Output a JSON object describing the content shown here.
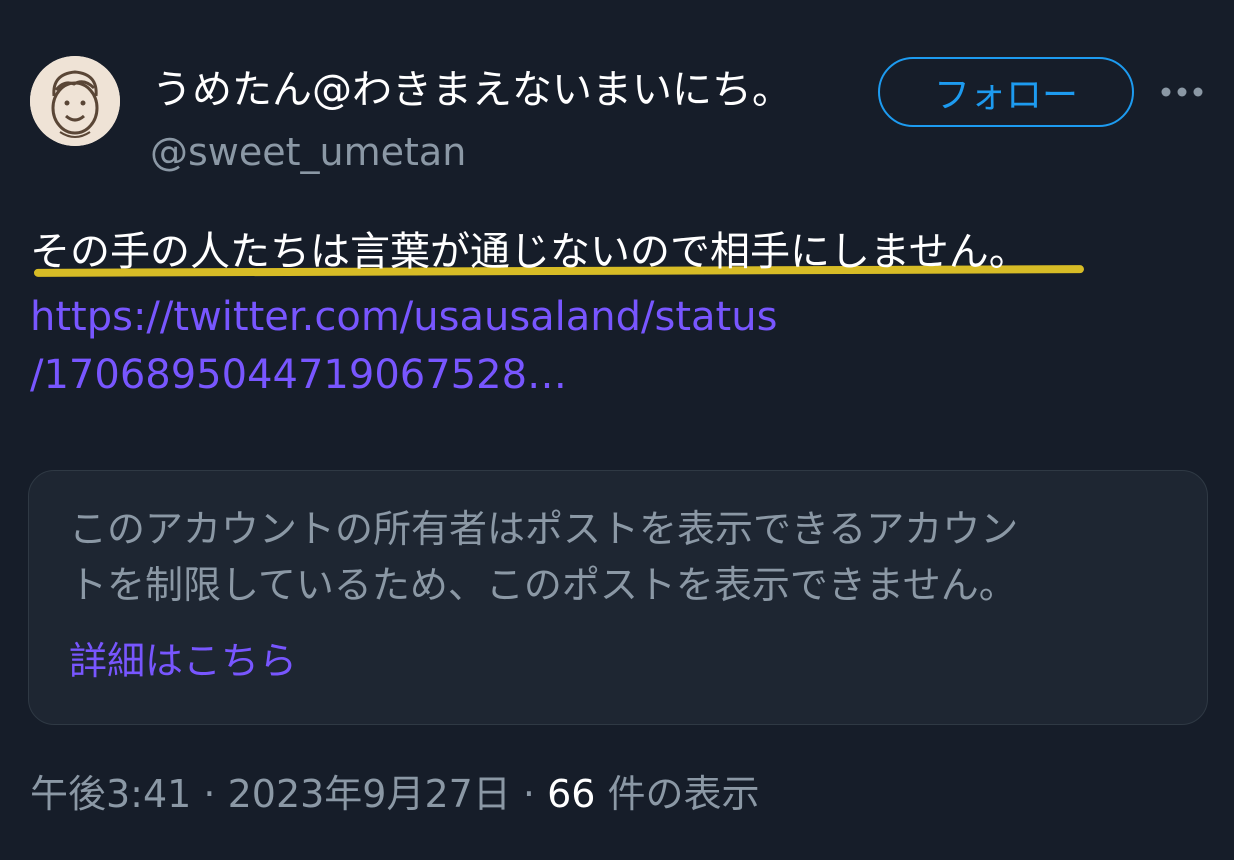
{
  "author": {
    "display_name": "うめたん@わきまえないまいにち。",
    "handle": "@sweet_umetan",
    "avatar_icon": "avatar-face-sketch"
  },
  "follow_button_label": "フォロー",
  "more_icon": "more-options-icon",
  "post": {
    "text": "その手の人たちは言葉が通じないので相手にしません。",
    "link_line_1": "https://twitter.com/usausaland/status",
    "link_line_2": "/1706895044719067528…",
    "highlight_color": "#e2c526"
  },
  "unavailable_notice": {
    "line_1": "このアカウントの所有者はポストを表示できるアカウン",
    "line_2": "トを制限しているため、このポストを表示できません。",
    "learn_more_label": "詳細はこちら"
  },
  "meta": {
    "time": "午後3:41",
    "separator_1": " · ",
    "date": "2023年9月27日",
    "separator_2": " · ",
    "views_count": "66",
    "views_label": " 件の表示"
  },
  "colors": {
    "background": "#161d29",
    "accent_blue": "#1d9bf0",
    "link_purple": "#7856ff",
    "muted_text": "#8b98a5"
  }
}
